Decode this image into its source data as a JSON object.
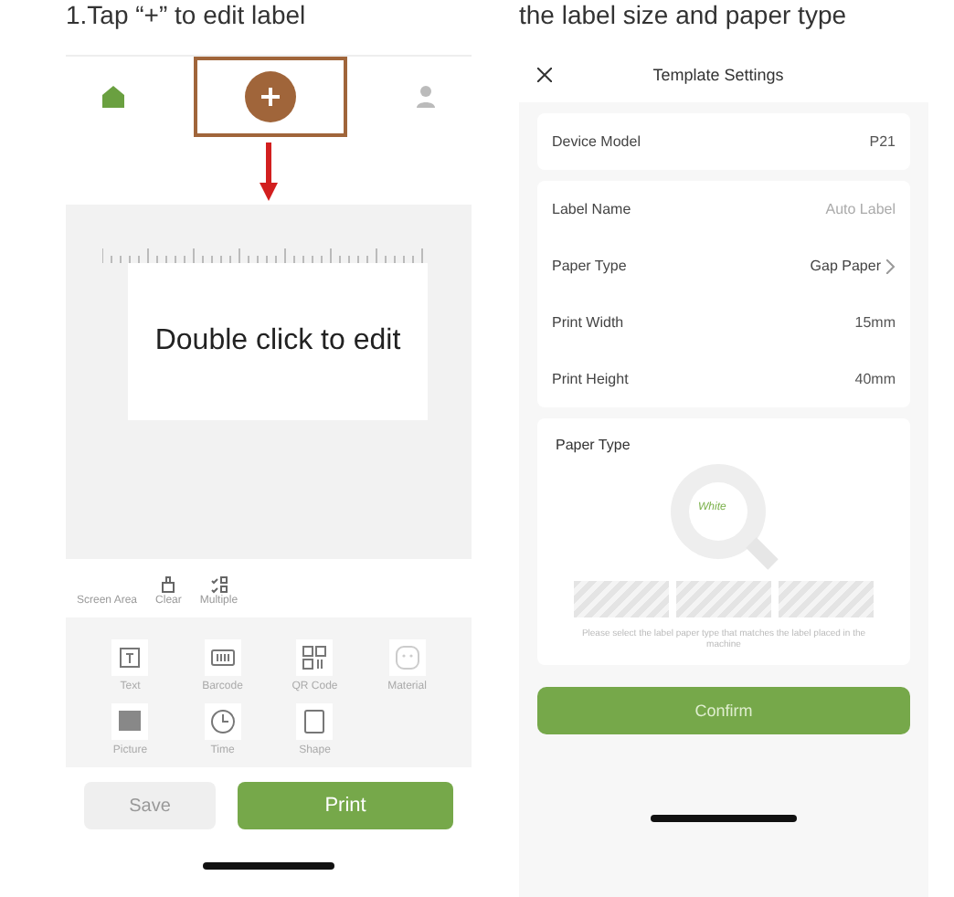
{
  "left_caption": "1.Tap “+” to edit label",
  "right_caption": "the label size and paper type",
  "editor": {
    "nav": [
      {
        "kind": "home",
        "selected": true
      },
      {
        "kind": "add",
        "selected": false
      },
      {
        "kind": "user",
        "selected": false
      }
    ],
    "canvas_text": "Double click to edit",
    "tools": [
      {
        "label": "Screen Area",
        "kind": "none"
      },
      {
        "label": "Clear",
        "kind": "brush"
      },
      {
        "label": "Multiple",
        "kind": "multi"
      }
    ],
    "elements": [
      {
        "label": "Text",
        "kind": "text"
      },
      {
        "label": "Barcode",
        "kind": "barcode"
      },
      {
        "label": "QR Code",
        "kind": "qr"
      },
      {
        "label": "Material",
        "kind": "face"
      },
      {
        "label": "Picture",
        "kind": "picture"
      },
      {
        "label": "Time",
        "kind": "clock"
      },
      {
        "label": "Shape",
        "kind": "shape"
      }
    ],
    "save": "Save",
    "print": "Print"
  },
  "settings": {
    "title": "Template Settings",
    "device": {
      "label": "Device Model",
      "value": "P21"
    },
    "rows": [
      {
        "label": "Label Name",
        "placeholder": "Auto Label",
        "kind": "field"
      },
      {
        "label": "Paper Type",
        "value": "Gap Paper",
        "kind": "link"
      },
      {
        "label": "Print Width",
        "value": "15mm",
        "kind": "plain"
      },
      {
        "label": "Print Height",
        "value": "40mm",
        "kind": "plain"
      }
    ],
    "paper_heading": "Paper Type",
    "roll_label": "White",
    "hint": "Please select the label paper type that matches the label placed in the machine",
    "confirm": "Confirm"
  }
}
